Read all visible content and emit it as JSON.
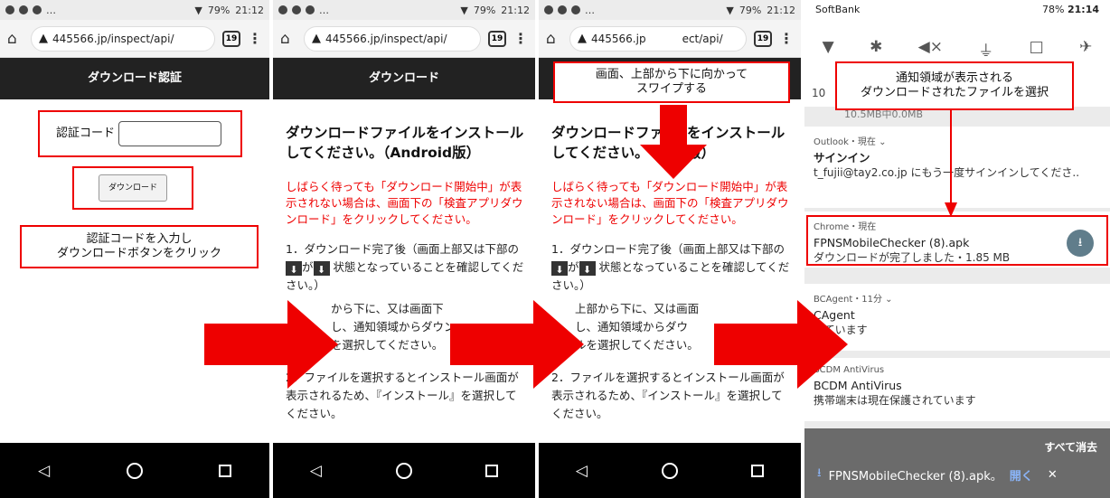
{
  "phone": {
    "status_time": "21:12",
    "battery": "79%",
    "url": "445566.jp/inspect/api/",
    "url_short": "445566.jp",
    "url_tail": "ect/api/",
    "tab_count": "19",
    "nav_back": "◁",
    "nav_home": "○",
    "nav_recent": "□"
  },
  "panel1": {
    "title": "ダウンロード認証",
    "auth_label": "認証コード",
    "download_button": "ダウンロード",
    "callout": "認証コードを入力し\nダウンロードボタンをクリック"
  },
  "panel2": {
    "title": "ダウンロード",
    "heading": "ダウンロードファイルをインストールしてください。（Android版）",
    "warning": "しばらく待っても「ダウンロード開始中」が表示されない場合は、画面下の「検査アプリダウンロード」をクリックしてください。",
    "step1a": "1．ダウンロード完了後（画面上部又は下部の",
    "step1b": "状態となっていることを確認してください。）",
    "step1_ga": "が",
    "step1c": "から下に、又は画面下",
    "step1d": "し、通知領域からダウン",
    "step1e": "を選択してください。",
    "step2": "2．ファイルを選択するとインストール画面が表示されるため、『インストール』を選択してください。"
  },
  "panel3": {
    "callout": "画面、上部から下に向かって\nスワイプする",
    "heading_a": "ダウンロードファ",
    "heading_b": "をインストール",
    "heading_c": "してください。",
    "heading_d": "id版）",
    "step1c": "上部から下に、又は画面",
    "step1d": "し、通知領域からダウ",
    "step1e": "ルを選択してください。"
  },
  "panel4": {
    "carrier": "SoftBank",
    "battery": "78%",
    "time": "21:14",
    "callout": "通知領域が表示される\nダウンロードされたファイルを選択",
    "partial_line": "10.5MB中0.0MB",
    "row_prefix": "10",
    "n1_app": "Outlook・現在 ⌄",
    "n1_title": "サインイン",
    "n1_body": "t_fujii@tay2.co.jp にもう一度サインインしてくださ..",
    "n2_app": "Chrome・現在",
    "n2_title": "FPNSMobileChecker (8).apk",
    "n2_body": "ダウンロードが完了しました・1.85 MB",
    "n3_app": "BCAgent・11分 ⌄",
    "n3_title": "CAgent",
    "n3_body": "しています",
    "n4_app": "BCDM AntiVirus",
    "n4_title": "BCDM AntiVirus",
    "n4_body": "携帯端末は現在保護されています",
    "clear_all": "すべて消去",
    "bar_file": "FPNSMobileChecker (8).apk。",
    "bar_open": "開く",
    "bar_close": "✕"
  }
}
